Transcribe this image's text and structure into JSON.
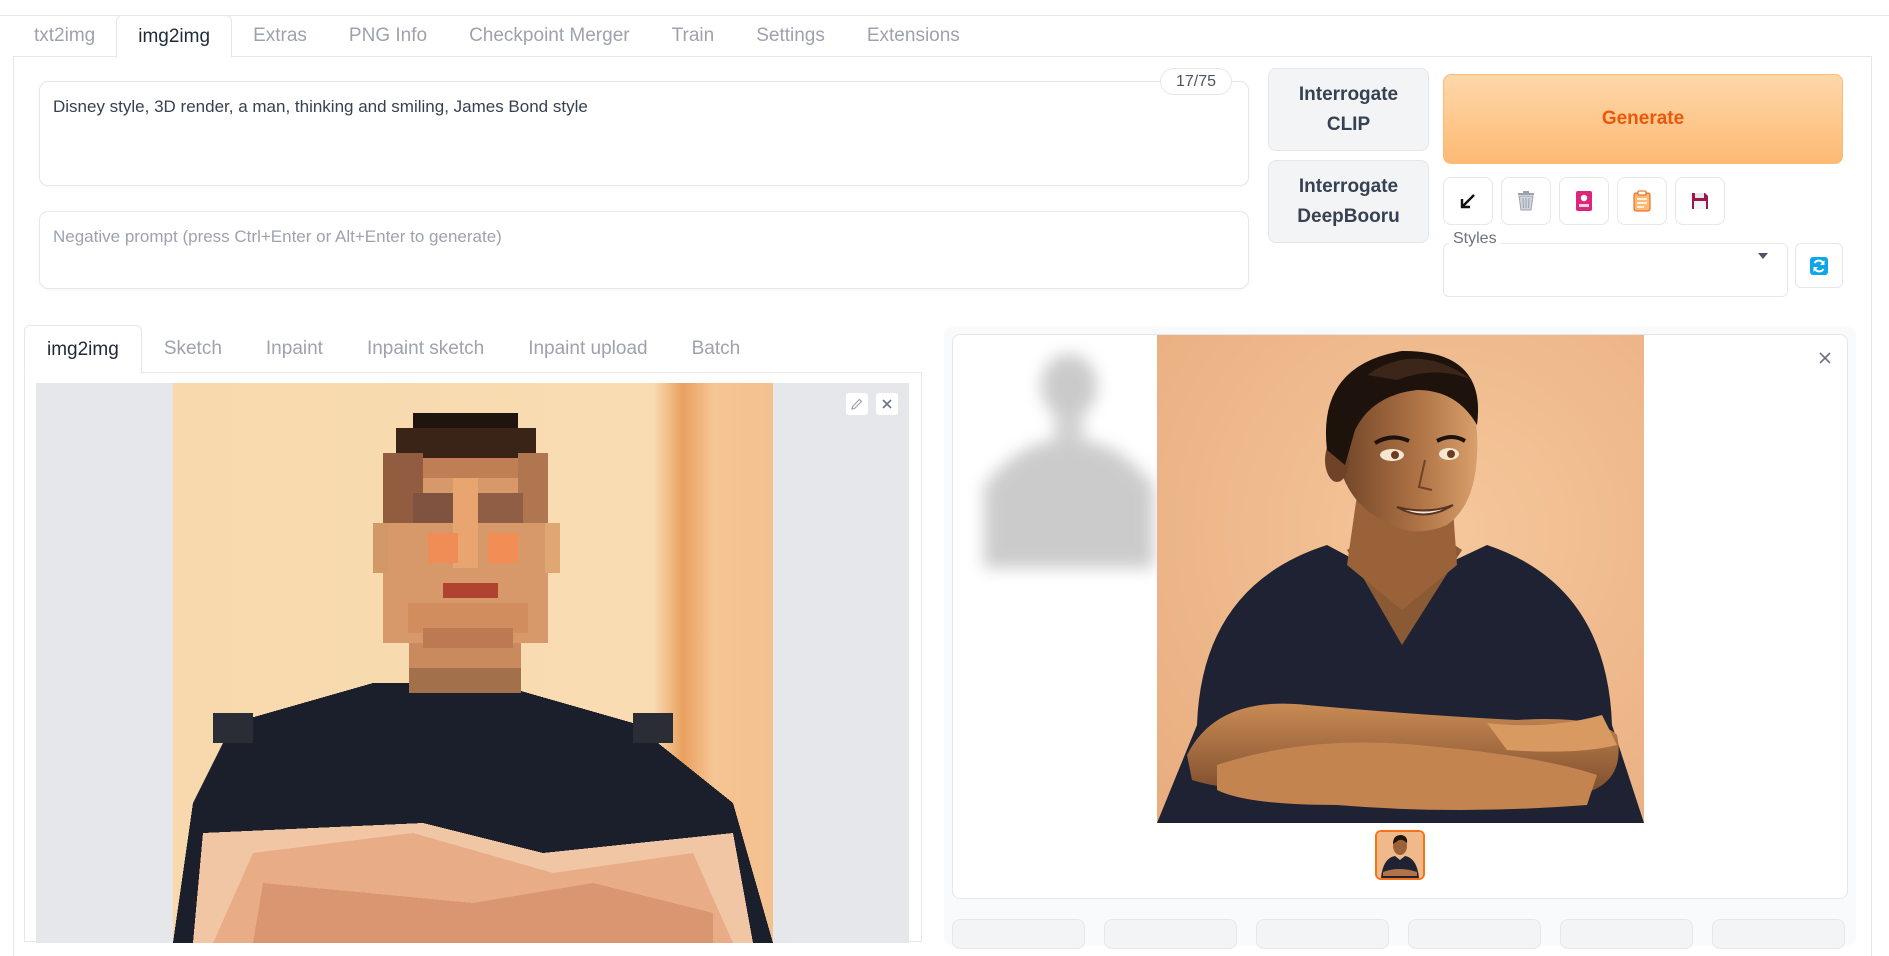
{
  "top_tabs": [
    "txt2img",
    "img2img",
    "Extras",
    "PNG Info",
    "Checkpoint Merger",
    "Train",
    "Settings",
    "Extensions"
  ],
  "active_top_tab": "img2img",
  "prompt": {
    "text": "Disney style, 3D render, a man, thinking and smiling, James Bond style",
    "token_counter": "17/75"
  },
  "negative_prompt": {
    "placeholder": "Negative prompt (press Ctrl+Enter or Alt+Enter to generate)"
  },
  "buttons": {
    "interrogate_clip": "Interrogate CLIP",
    "interrogate_deepbooru": "Interrogate DeepBooru",
    "generate": "Generate"
  },
  "tool_icons": [
    "arrow-down-left-icon",
    "trash-icon",
    "red-card-icon",
    "clipboard-icon",
    "save-icon"
  ],
  "styles": {
    "label": "Styles",
    "value": ""
  },
  "sub_tabs": [
    "img2img",
    "Sketch",
    "Inpaint",
    "Inpaint sketch",
    "Inpaint upload",
    "Batch"
  ],
  "active_sub_tab": "img2img",
  "colors": {
    "accent": "#f97316",
    "generate_text": "#ea580c",
    "generate_bg": "#fdba74",
    "refresh_icon": "#0ea5e9"
  }
}
